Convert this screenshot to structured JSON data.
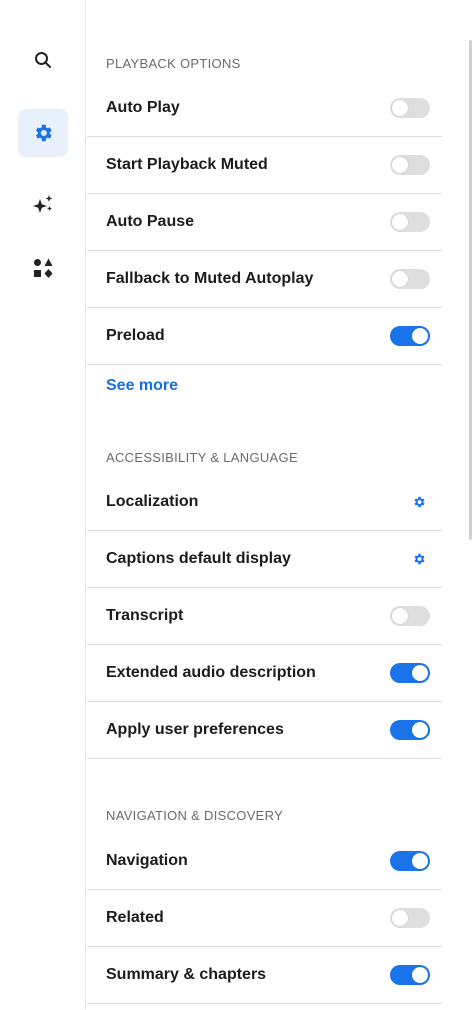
{
  "rail": {
    "items": [
      {
        "icon": "search-icon",
        "active": false
      },
      {
        "icon": "gear-icon",
        "active": true
      },
      {
        "icon": "sparkles-icon",
        "active": false
      },
      {
        "icon": "shapes-icon",
        "active": false
      }
    ]
  },
  "accent_color": "#1a73e8",
  "sections": {
    "playback": {
      "title": "PLAYBACK OPTIONS",
      "rows": [
        {
          "label": "Auto Play",
          "control": "toggle",
          "on": false
        },
        {
          "label": "Start Playback Muted",
          "control": "toggle",
          "on": false
        },
        {
          "label": "Auto Pause",
          "control": "toggle",
          "on": false
        },
        {
          "label": "Fallback to Muted Autoplay",
          "control": "toggle",
          "on": false
        },
        {
          "label": "Preload",
          "control": "toggle",
          "on": true
        }
      ],
      "see_more": "See more"
    },
    "accessibility": {
      "title": "ACCESSIBILITY & LANGUAGE",
      "rows": [
        {
          "label": "Localization",
          "control": "gear-icon"
        },
        {
          "label": "Captions default display",
          "control": "gear-icon"
        },
        {
          "label": "Transcript",
          "control": "toggle",
          "on": false
        },
        {
          "label": "Extended audio description",
          "control": "toggle",
          "on": true
        },
        {
          "label": "Apply user preferences",
          "control": "toggle",
          "on": true
        }
      ]
    },
    "navigation": {
      "title": "NAVIGATION & DISCOVERY",
      "rows": [
        {
          "label": "Navigation",
          "control": "toggle",
          "on": true
        },
        {
          "label": "Related",
          "control": "toggle",
          "on": false
        },
        {
          "label": "Summary & chapters",
          "control": "toggle",
          "on": true
        }
      ]
    }
  }
}
